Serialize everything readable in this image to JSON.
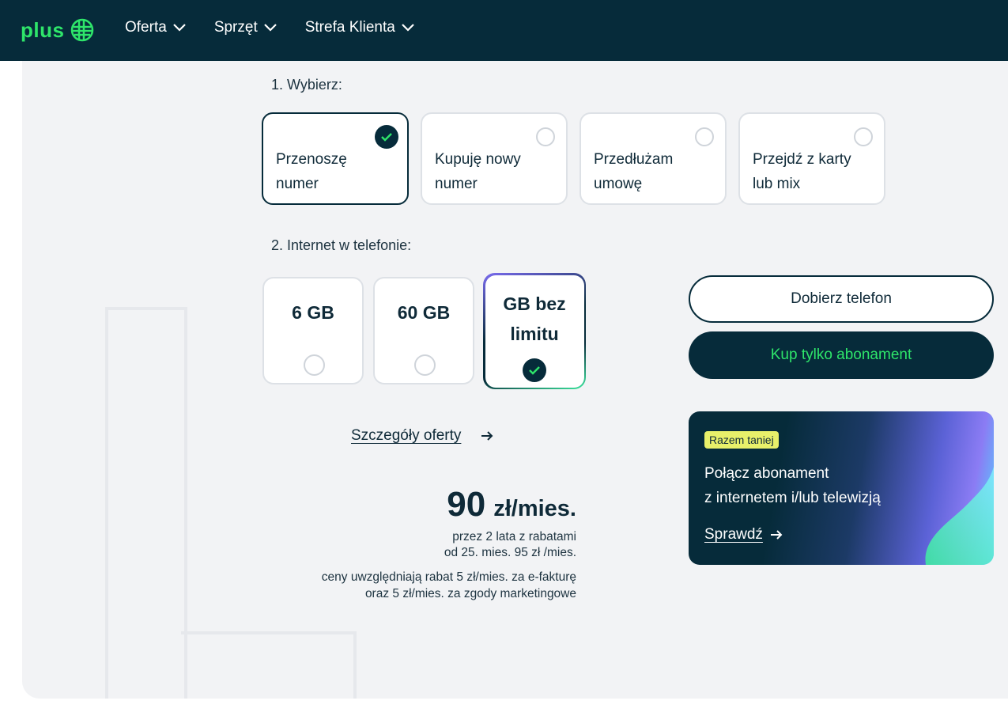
{
  "header": {
    "logo_text": "plus",
    "nav": [
      {
        "label": "Oferta"
      },
      {
        "label": "Sprzęt"
      },
      {
        "label": "Strefa Klienta"
      }
    ]
  },
  "step1": {
    "title": "1. Wybierz:",
    "options": [
      {
        "label": "Przenoszę\nnumer",
        "selected": true
      },
      {
        "label": "Kupuję nowy\nnumer",
        "selected": false
      },
      {
        "label": "Przedłużam\numowę",
        "selected": false
      },
      {
        "label": "Przejdź z karty\nlub mix",
        "selected": false
      }
    ]
  },
  "step2": {
    "title": "2. Internet w telefonie:",
    "options": [
      {
        "label": "6 GB",
        "selected": false
      },
      {
        "label": "60 GB",
        "selected": false
      },
      {
        "label": "GB bez\nlimitu",
        "selected": true
      }
    ]
  },
  "offer_link": "Szczegóły oferty",
  "price": {
    "amount": "90",
    "unit": "zł/mies.",
    "line1": "przez 2 lata z rabatami",
    "line2": "od 25. mies. 95 zł /mies.",
    "note1": "ceny uwzględniają rabat 5 zł/mies. za e-fakturę",
    "note2": "oraz 5 zł/mies. za zgody marketingowe"
  },
  "buttons": {
    "choose_phone": "Dobierz telefon",
    "buy_plan": "Kup tylko abonament"
  },
  "promo": {
    "badge": "Razem taniej",
    "text": "Połącz abonament\nz internetem i/lub telewizją",
    "link": "Sprawdź"
  },
  "colors": {
    "brand_dark": "#062b3a",
    "brand_green": "#2ee56a",
    "badge_yellow": "#e8f06a"
  }
}
